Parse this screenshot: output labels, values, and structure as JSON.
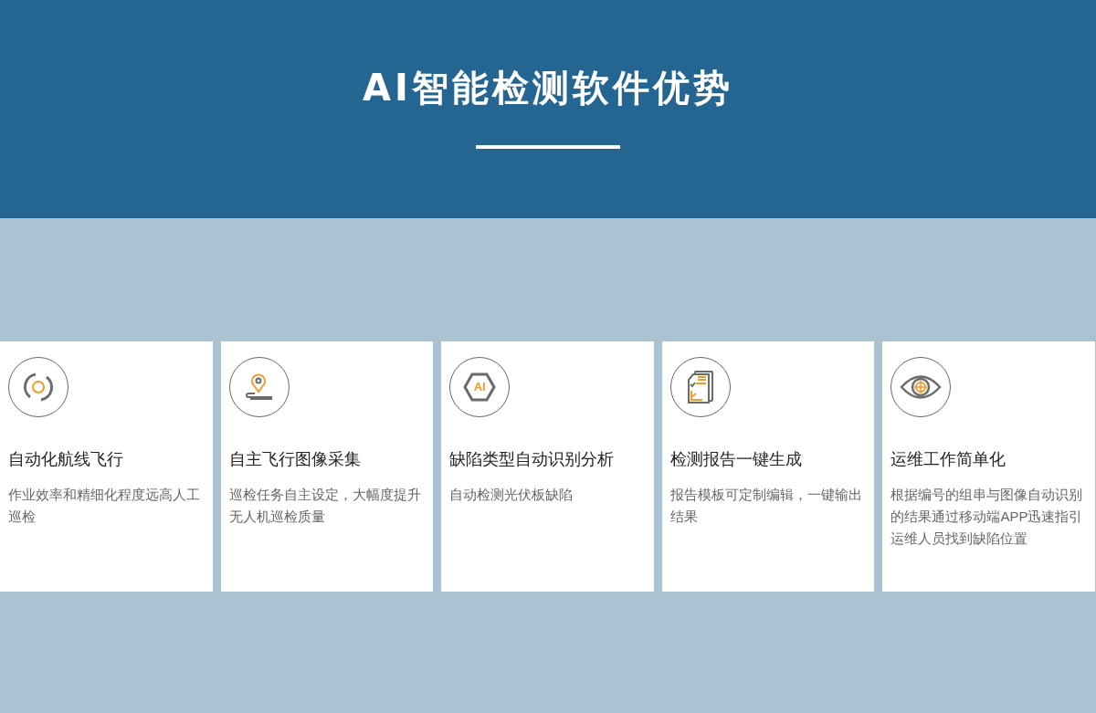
{
  "header": {
    "title": "AI智能检测软件优势"
  },
  "cards": [
    {
      "kind": "route",
      "title": "自动化航线飞行",
      "description": "作业效率和精细化程度远高人工巡检"
    },
    {
      "kind": "pin",
      "title": "自主飞行图像采集",
      "description": "巡检任务自主设定，大幅度提升无人机巡检质量"
    },
    {
      "kind": "ai",
      "icon_label": "AI",
      "title": "缺陷类型自动识别分析",
      "description": "自动检测光伏板缺陷"
    },
    {
      "kind": "report",
      "title": "检测报告一键生成",
      "description": "报告模板可定制编辑，一键输出结果"
    },
    {
      "kind": "eye",
      "title": "运维工作简单化",
      "description": "根据编号的组串与图像自动识别的结果通过移动端APP迅速指引运维人员找到缺陷位置"
    }
  ]
}
